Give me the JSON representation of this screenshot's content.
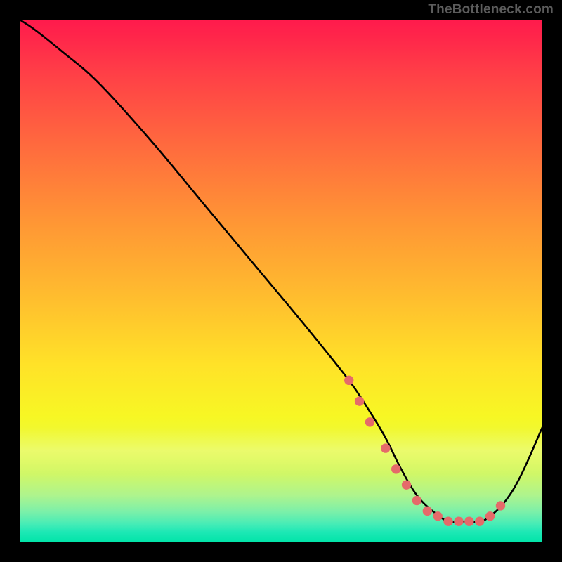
{
  "watermark": "TheBottleneck.com",
  "chart_data": {
    "type": "line",
    "title": "",
    "xlabel": "",
    "ylabel": "",
    "xlim": [
      0,
      100
    ],
    "ylim": [
      0,
      100
    ],
    "grid": false,
    "legend": false,
    "background": "rainbow-vertical-gradient",
    "series": [
      {
        "name": "bottleneck-curve",
        "color": "#000000",
        "x": [
          0,
          3,
          8,
          15,
          25,
          35,
          45,
          55,
          63,
          67,
          70,
          73,
          76,
          79,
          82,
          85,
          88,
          90,
          93,
          96,
          100
        ],
        "y": [
          100,
          98,
          94,
          88,
          77,
          65,
          53,
          41,
          31,
          25,
          20,
          14,
          9,
          6,
          4,
          4,
          4,
          5,
          8,
          13,
          22
        ]
      }
    ],
    "markers": {
      "name": "highlight-points",
      "color": "#e56a6a",
      "radius": 5,
      "x": [
        63,
        65,
        67,
        70,
        72,
        74,
        76,
        78,
        80,
        82,
        84,
        86,
        88,
        90,
        92
      ],
      "y": [
        31,
        27,
        23,
        18,
        14,
        11,
        8,
        6,
        5,
        4,
        4,
        4,
        4,
        5,
        7
      ]
    }
  }
}
